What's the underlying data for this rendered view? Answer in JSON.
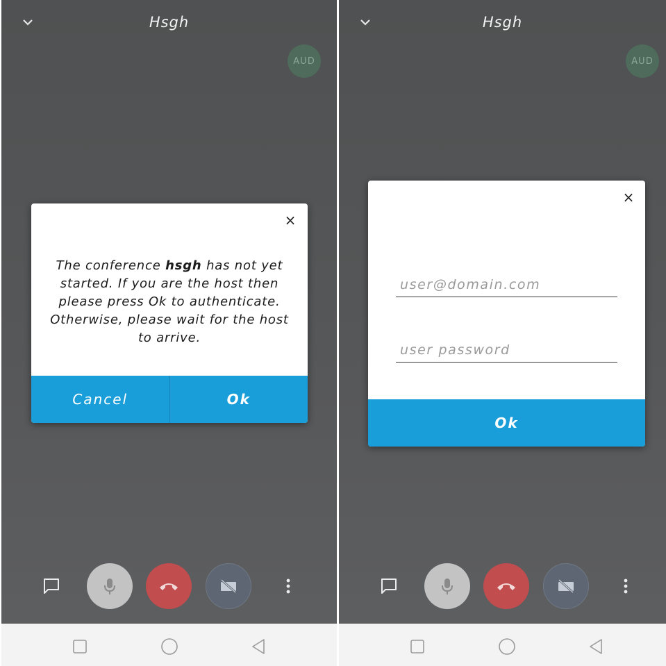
{
  "conference": {
    "title": "Hsgh",
    "audio_badge": "AUD"
  },
  "waiting_dialog": {
    "message_before": "The conference ",
    "room_name": "hsgh",
    "message_after": " has not yet started. If you are the host then please press Ok to authenticate. Otherwise, please wait for the host to arrive.",
    "close_label": "×",
    "cancel_label": "Cancel",
    "ok_label": "Ok"
  },
  "login_dialog": {
    "close_label": "×",
    "username_placeholder": "user@domain.com",
    "password_placeholder": "user password",
    "ok_label": "Ok"
  },
  "toolbar": {
    "colors": {
      "mic": "#c3c3c3",
      "hangup": "#c24d4f",
      "video": "#5e6673",
      "accent": "#1a9ed9"
    }
  }
}
